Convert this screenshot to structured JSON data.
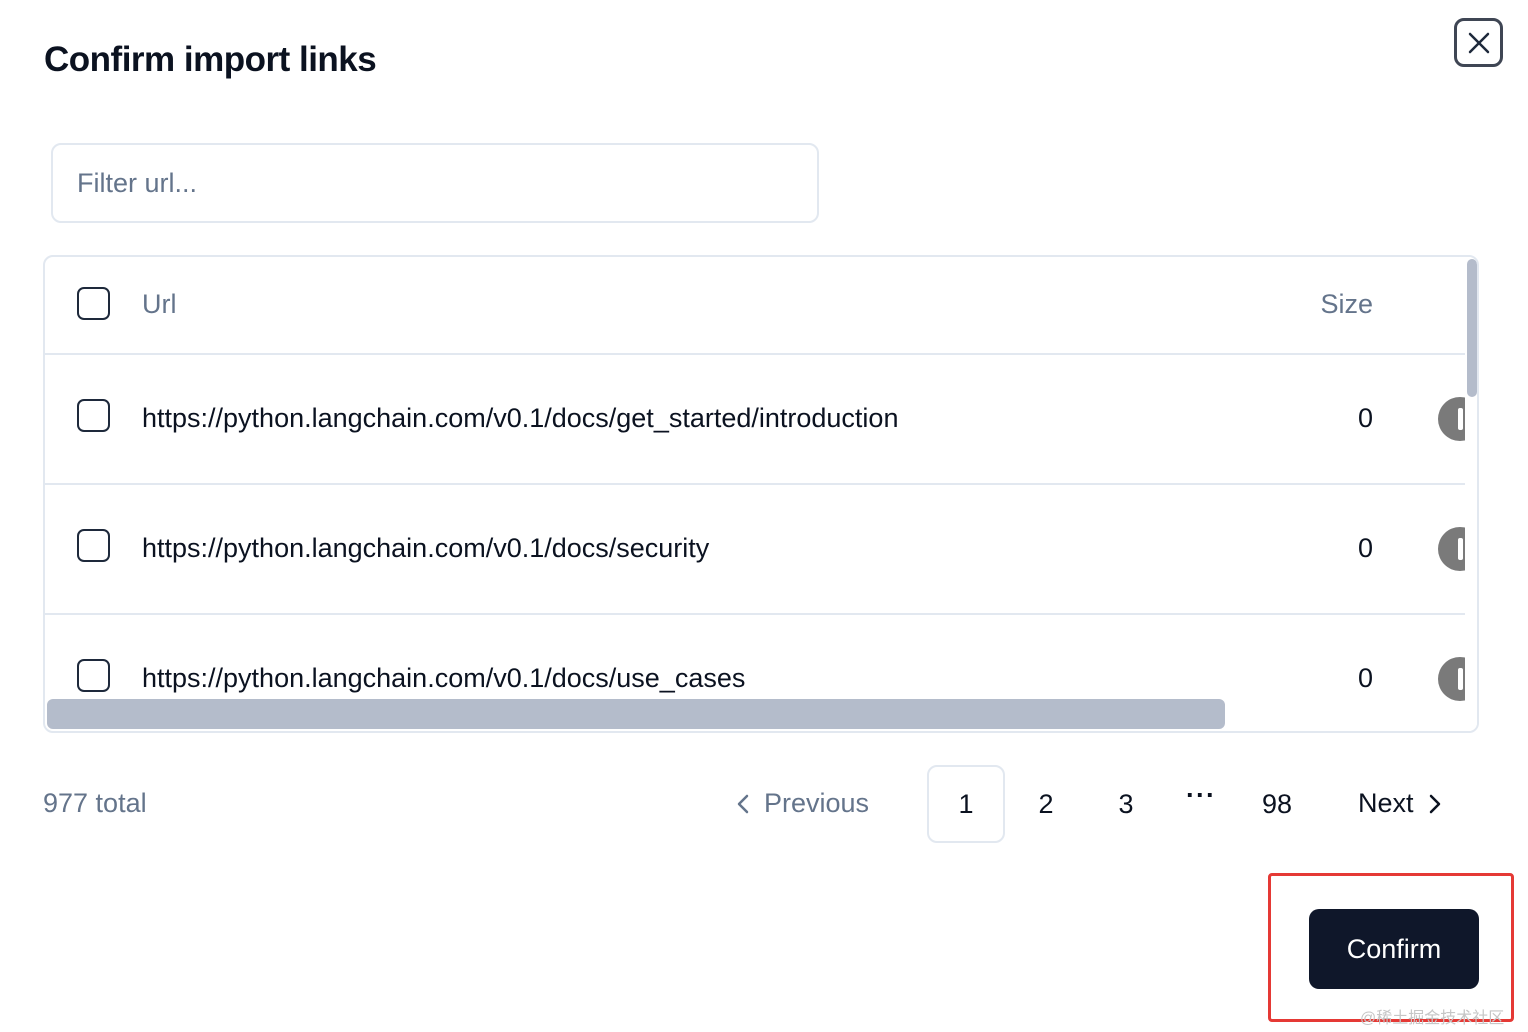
{
  "dialog": {
    "title": "Confirm import links",
    "close_icon": "close-icon"
  },
  "filter": {
    "placeholder": "Filter url...",
    "value": ""
  },
  "table": {
    "headers": {
      "url": "Url",
      "size": "Size"
    },
    "rows": [
      {
        "url": "https://python.langchain.com/v0.1/docs/get_started/introduction",
        "size": "0"
      },
      {
        "url": "https://python.langchain.com/v0.1/docs/security",
        "size": "0"
      },
      {
        "url": "https://python.langchain.com/v0.1/docs/use_cases",
        "size": "0"
      }
    ]
  },
  "pagination": {
    "total_label": "977 total",
    "previous_label": "Previous",
    "next_label": "Next",
    "pages": [
      "1",
      "2",
      "3",
      "98"
    ],
    "ellipsis": "···",
    "current_page": "1"
  },
  "footer": {
    "confirm_label": "Confirm"
  },
  "watermark": "@稀土掘金技术社区",
  "colors": {
    "primary": "#0f172a",
    "muted": "#64748b",
    "border": "#e2e8f0",
    "highlight": "#e53935"
  }
}
